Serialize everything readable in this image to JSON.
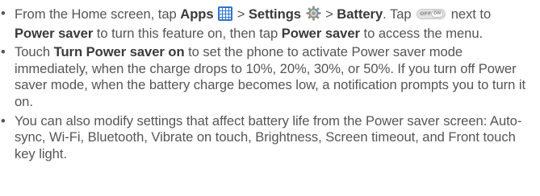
{
  "bullet_symbol": "•",
  "items": [
    {
      "p1": "From the Home screen, tap ",
      "b1": "Apps",
      "apps_icon": "apps-grid-icon",
      "p2": " > ",
      "b2": "Settings",
      "settings_icon": "settings-gear-icon",
      "p3": " > ",
      "b3": "Battery",
      "p4": ". Tap ",
      "toggle_off": "OFF",
      "toggle_on": "ON",
      "p5": " next to ",
      "b5": "Power saver",
      "p6": " to turn this feature on, then tap ",
      "b6": "Power saver",
      "p7": " to access the menu."
    },
    {
      "p1": "Touch ",
      "b1": "Turn Power saver on",
      "p2": " to set the phone to activate Power saver mode immediately, when the charge drops to 10%, 20%, 30%, or 50%. If you turn off Power saver mode, when the battery charge becomes low, a notification prompts you to turn it on."
    },
    {
      "p1": "You can also modify settings that affect battery life from the Power saver screen: Auto-sync, Wi-Fi, Bluetooth, Vibrate on touch, Brightness, Screen timeout, and Front touch key light."
    }
  ],
  "colors": {
    "text": "#555555",
    "bold_text": "#3a3a3a",
    "apps_icon": "#2f76c8"
  }
}
